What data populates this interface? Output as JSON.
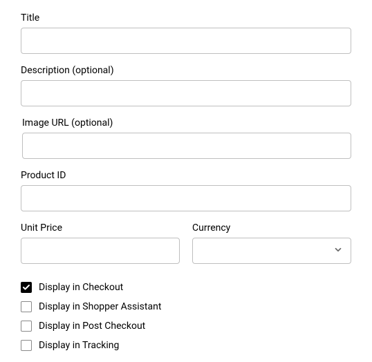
{
  "fields": {
    "title": {
      "label": "Title",
      "value": ""
    },
    "description": {
      "label": "Description (optional)",
      "value": ""
    },
    "image_url": {
      "label": "Image URL (optional)",
      "value": ""
    },
    "product_id": {
      "label": "Product ID",
      "value": ""
    },
    "unit_price": {
      "label": "Unit Price",
      "value": ""
    },
    "currency": {
      "label": "Currency",
      "value": ""
    }
  },
  "checkboxes": {
    "checkout": {
      "label": "Display in Checkout",
      "checked": true
    },
    "shopper_assistant": {
      "label": "Display in Shopper Assistant",
      "checked": false
    },
    "post_checkout": {
      "label": "Display in Post Checkout",
      "checked": false
    },
    "tracking": {
      "label": "Display in Tracking",
      "checked": false
    }
  }
}
